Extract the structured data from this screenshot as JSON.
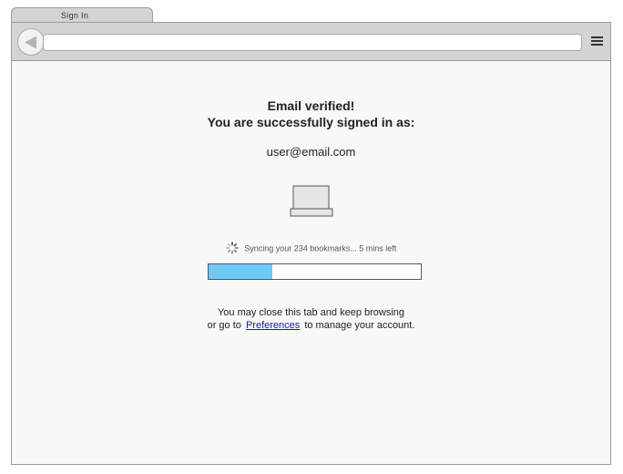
{
  "tab": {
    "label": "Sign In"
  },
  "address_bar": {
    "value": ""
  },
  "heading": {
    "line1": "Email verified!",
    "line2": "You are successfully signed in as:"
  },
  "user_email": "user@email.com",
  "icons": {
    "back": "back-arrow-icon",
    "menu": "hamburger-menu-icon",
    "device": "laptop-icon",
    "spinner": "loading-spinner-icon"
  },
  "sync": {
    "status_text": "Syncing your 234 bookmarks... 5 mins left",
    "progress": 0.3
  },
  "footer": {
    "line1": "You may close this tab and keep browsing",
    "line2_prefix": "or go to",
    "link_label": "Preferences",
    "line2_suffix": "to manage your account."
  },
  "colors": {
    "progress_fill": "#6fcaf7",
    "link": "#1a1aa6",
    "chrome": "#d4d4d4"
  }
}
